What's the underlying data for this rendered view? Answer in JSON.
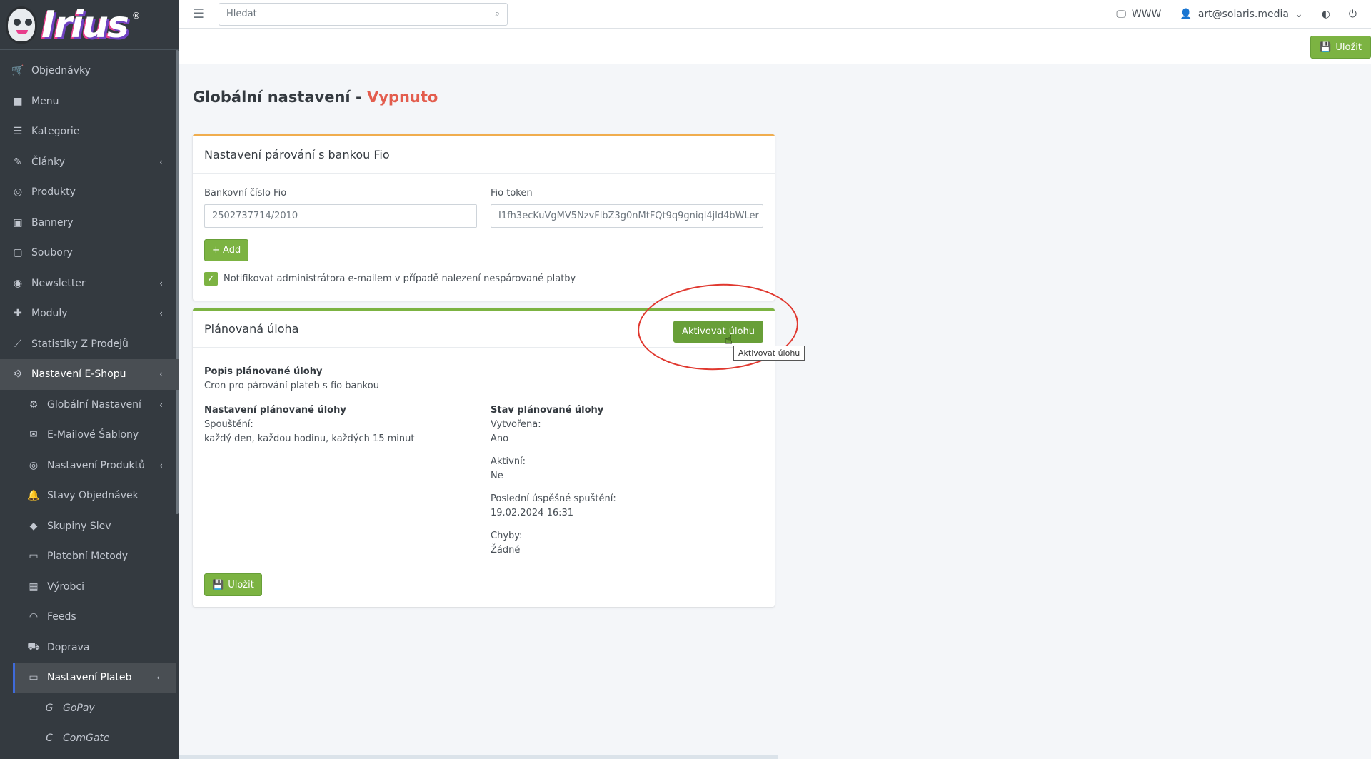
{
  "brand": {
    "logo_text": "Irius",
    "logo_mark": "®"
  },
  "topbar": {
    "search_placeholder": "Hledat",
    "www_label": "WWW",
    "user_email": "art@solaris.media"
  },
  "header": {
    "save_label": "Uložit"
  },
  "sidebar": {
    "items": [
      {
        "label": "Objednávky",
        "icon": "cart-icon",
        "glyph": "🛒"
      },
      {
        "label": "Menu",
        "icon": "folder-icon",
        "glyph": "■"
      },
      {
        "label": "Kategorie",
        "icon": "list-icon",
        "glyph": "☰"
      },
      {
        "label": "Články",
        "icon": "pencil-icon",
        "glyph": "✎",
        "chevron": "‹"
      },
      {
        "label": "Produkty",
        "icon": "basketball-icon",
        "glyph": "◎"
      },
      {
        "label": "Bannery",
        "icon": "image-icon",
        "glyph": "▣"
      },
      {
        "label": "Soubory",
        "icon": "file-icon",
        "glyph": "▢"
      },
      {
        "label": "Newsletter",
        "icon": "mail-circle-icon",
        "glyph": "◉",
        "chevron": "‹"
      },
      {
        "label": "Moduly",
        "icon": "puzzle-icon",
        "glyph": "✚",
        "chevron": "‹"
      },
      {
        "label": "Statistiky Z Prodejů",
        "icon": "chart-line-icon",
        "glyph": "⟋"
      },
      {
        "label": "Nastavení E-Shopu",
        "icon": "cogs-icon",
        "glyph": "⚙",
        "chevron": "‹"
      }
    ],
    "subitems": [
      {
        "label": "Globální Nastavení",
        "icon": "gear-icon",
        "glyph": "⚙",
        "chevron": "‹"
      },
      {
        "label": "E-Mailové Šablony",
        "icon": "envelope-icon",
        "glyph": "✉"
      },
      {
        "label": "Nastavení Produktů",
        "icon": "basketball-icon",
        "glyph": "◎",
        "chevron": "‹"
      },
      {
        "label": "Stavy Objednávek",
        "icon": "bell-icon",
        "glyph": "🔔"
      },
      {
        "label": "Skupiny Slev",
        "icon": "tag-icon",
        "glyph": "◆"
      },
      {
        "label": "Platební Metody",
        "icon": "credit-card-icon",
        "glyph": "▭"
      },
      {
        "label": "Výrobci",
        "icon": "building-icon",
        "glyph": "▦"
      },
      {
        "label": "Feeds",
        "icon": "rss-icon",
        "glyph": "◠"
      },
      {
        "label": "Doprava",
        "icon": "truck-icon",
        "glyph": "⛟"
      },
      {
        "label": "Nastavení Plateb",
        "icon": "credit-card-icon",
        "glyph": "▭",
        "chevron": "‹"
      }
    ],
    "subsubitems": [
      {
        "label": "GoPay",
        "icon": "gopay-icon",
        "glyph": "G"
      },
      {
        "label": "ComGate",
        "icon": "comgate-icon",
        "glyph": "C"
      }
    ]
  },
  "page": {
    "title": "Globální nastavení -",
    "status": "Vypnuto"
  },
  "fio_card": {
    "title": "Nastavení párování s bankou Fio",
    "account_label": "Bankovní číslo Fio",
    "account_value": "2502737714/2010",
    "token_label": "Fio token",
    "token_value": "I1fh3ecKuVgMV5NzvFlbZ3g0nMtFQt9q9gniql4jld4bWLer",
    "add_label": "+ Add",
    "notify_label": "Notifikovat administrátora e-mailem v případě nalezení nespárované platby"
  },
  "task_card": {
    "title": "Plánovaná úloha",
    "activate_label": "Aktivovat úlohu",
    "tooltip": "Aktivovat úlohu",
    "desc_heading": "Popis plánované úlohy",
    "desc_text": "Cron pro párování plateb s fio bankou",
    "settings_heading": "Nastavení plánované úlohy",
    "run_label": "Spouštění:",
    "run_value": "každý den, každou hodinu, každých 15 minut",
    "state_heading": "Stav plánované úlohy",
    "created_label": "Vytvořena:",
    "created_value": "Ano",
    "active_label": "Aktivní:",
    "active_value": "Ne",
    "last_run_label": "Poslední úspěšné spuštění:",
    "last_run_value": "19.02.2024 16:31",
    "errors_label": "Chyby:",
    "errors_value": "Žádné",
    "save_label": "Uložit"
  },
  "colors": {
    "accent_green": "#7cb342",
    "status_off": "#e35d4e",
    "sidebar_bg": "#343a40",
    "highlight": "#e0382f"
  }
}
